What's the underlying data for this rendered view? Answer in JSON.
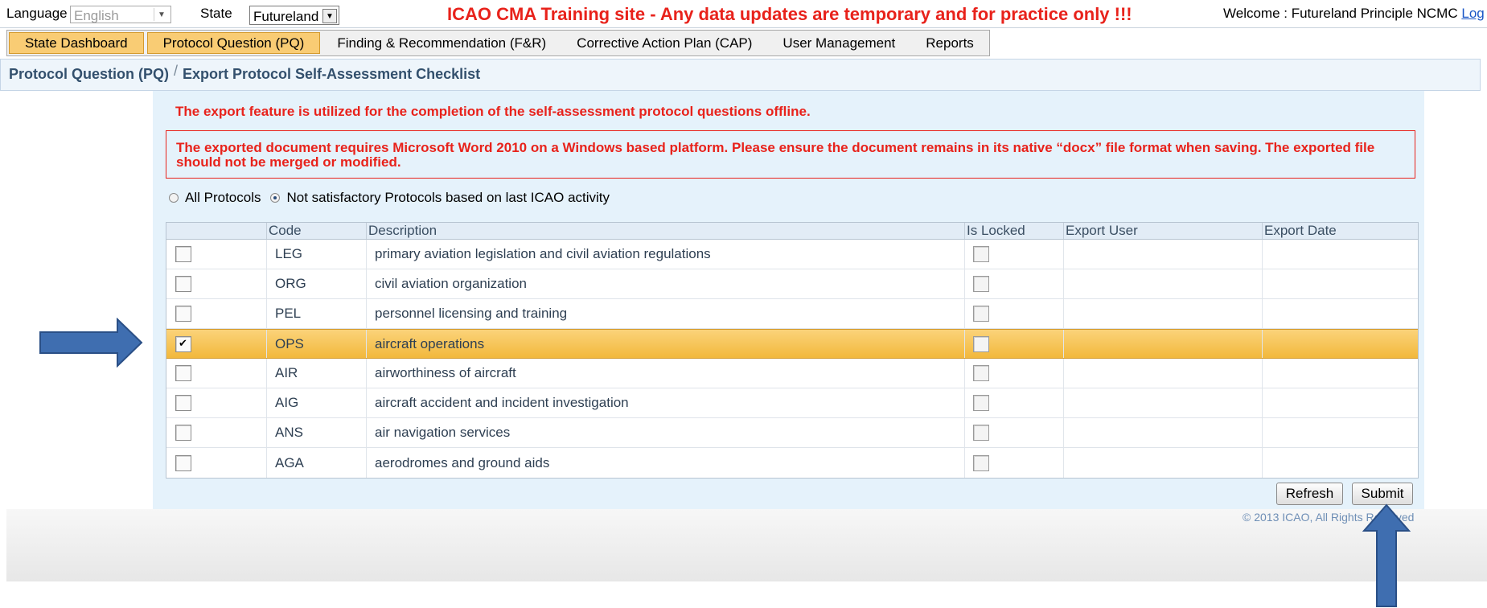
{
  "topbar": {
    "language_label": "Language",
    "language_value": "English",
    "state_label": "State",
    "state_value": "Futureland",
    "banner": "ICAO CMA Training site - Any data updates are temporary and for practice only !!!",
    "welcome_text": "Welcome : Futureland Principle NCMC",
    "welcome_link": "Log"
  },
  "menu": [
    {
      "label": "State Dashboard",
      "active": true
    },
    {
      "label": "Protocol Question (PQ)",
      "active": true
    },
    {
      "label": "Finding & Recommendation (F&R)",
      "active": false
    },
    {
      "label": "Corrective Action Plan (CAP)",
      "active": false
    },
    {
      "label": "User Management",
      "active": false
    },
    {
      "label": "Reports",
      "active": false
    }
  ],
  "breadcrumb": {
    "parent": "Protocol Question (PQ)",
    "separator": "/",
    "current": "Export Protocol Self-Assessment Checklist"
  },
  "notices": {
    "line1": "The export feature is utilized for the completion of the self-assessment protocol questions offline.",
    "line2": "The exported document requires Microsoft Word 2010 on a Windows based platform. Please ensure the document remains in its native “docx” file format when saving. The exported file should not be merged or modified."
  },
  "filter": {
    "option_all": "All Protocols",
    "option_not_sat": "Not satisfactory Protocols based on last ICAO activity",
    "selected": "not_satisfactory"
  },
  "table": {
    "columns": [
      "",
      "Code",
      "Description",
      "Is Locked",
      "Export User",
      "Export Date"
    ],
    "rows": [
      {
        "checked": false,
        "code": "LEG",
        "description": "primary aviation legislation and civil aviation regulations",
        "locked": false,
        "export_user": "",
        "export_date": ""
      },
      {
        "checked": false,
        "code": "ORG",
        "description": "civil aviation organization",
        "locked": false,
        "export_user": "",
        "export_date": ""
      },
      {
        "checked": false,
        "code": "PEL",
        "description": "personnel licensing and training",
        "locked": false,
        "export_user": "",
        "export_date": ""
      },
      {
        "checked": true,
        "code": "OPS",
        "description": "aircraft operations",
        "locked": false,
        "export_user": "",
        "export_date": ""
      },
      {
        "checked": false,
        "code": "AIR",
        "description": "airworthiness of aircraft",
        "locked": false,
        "export_user": "",
        "export_date": ""
      },
      {
        "checked": false,
        "code": "AIG",
        "description": "aircraft accident and incident investigation",
        "locked": false,
        "export_user": "",
        "export_date": ""
      },
      {
        "checked": false,
        "code": "ANS",
        "description": "air navigation services",
        "locked": false,
        "export_user": "",
        "export_date": ""
      },
      {
        "checked": false,
        "code": "AGA",
        "description": "aerodromes and ground aids",
        "locked": false,
        "export_user": "",
        "export_date": ""
      }
    ]
  },
  "buttons": {
    "refresh": "Refresh",
    "submit": "Submit"
  },
  "footer": {
    "copyright": "© 2013 ICAO, All Rights Reserved"
  },
  "colors": {
    "alert_red": "#e8221b",
    "menu_active": "#f9cc74",
    "selected_row": "#f2b83c",
    "annotation_arrow": "#3f6eb0"
  }
}
